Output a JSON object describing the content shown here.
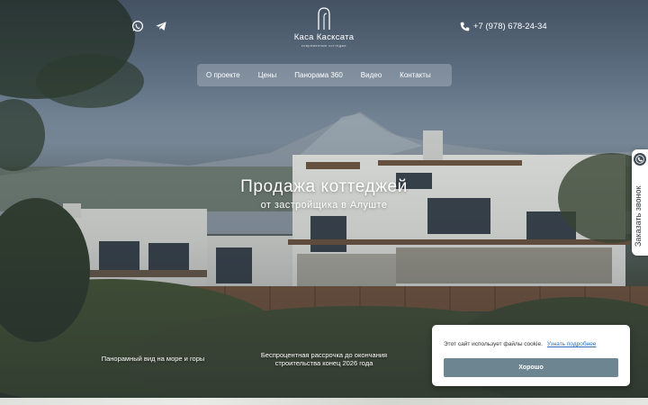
{
  "header": {
    "social": [
      {
        "icon": "whatsapp-icon"
      },
      {
        "icon": "telegram-icon"
      }
    ],
    "logo": {
      "name": "Каса Касксата",
      "subtitle": "современные коттеджи"
    },
    "phone": "+7 (978) 678-24-34"
  },
  "nav": {
    "items": [
      {
        "label": "О проекте"
      },
      {
        "label": "Цены"
      },
      {
        "label": "Панорама 360"
      },
      {
        "label": "Видео"
      },
      {
        "label": "Контакты"
      }
    ]
  },
  "hero": {
    "title": "Продажа коттеджей",
    "subtitle": "от застройщика в Алуште"
  },
  "features": [
    {
      "text": "Панорамный вид на море и горы"
    },
    {
      "text": "Беспроцентная рассрочка до окончания строительства конец 2026 года"
    }
  ],
  "callback": {
    "label": "Заказать звонок"
  },
  "cookie": {
    "text": "Этот сайт использует файлы cookie.",
    "link": "Узнать подробнее",
    "button": "Хорошо"
  },
  "colors": {
    "accent_button": "#6c8591",
    "link": "#2f6fb6"
  }
}
